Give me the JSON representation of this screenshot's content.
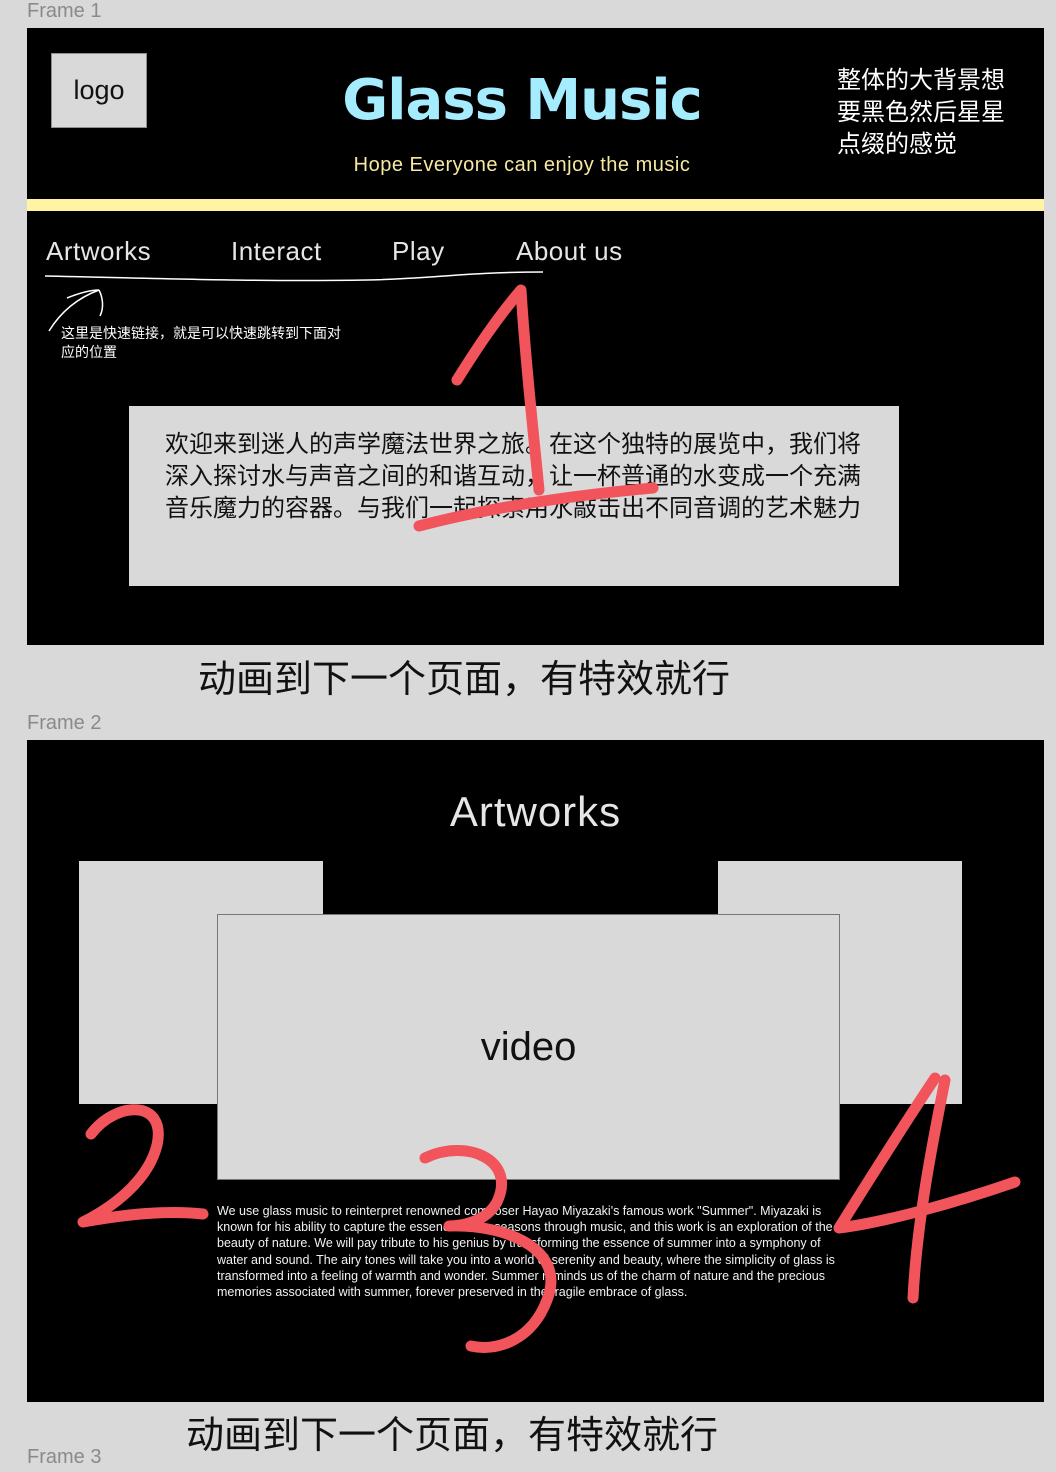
{
  "frames": [
    {
      "label": "Frame 1"
    },
    {
      "label": "Frame 2"
    },
    {
      "label": "Frame 3"
    }
  ],
  "header": {
    "logo_label": "logo",
    "title": "Glass Music",
    "subtitle": "Hope Everyone can enjoy the music",
    "background_note": "整体的大背景想要黑色然后星星点缀的感觉",
    "title_color": "#a6ecff",
    "subtitle_color": "#f7e9a0",
    "bar_color": "#fff4a3"
  },
  "nav": {
    "items": [
      {
        "label": "Artworks"
      },
      {
        "label": "Interact"
      },
      {
        "label": "Play"
      },
      {
        "label": "About us"
      }
    ],
    "note": "这里是快速链接，就是可以快速跳转到下面对应的位置"
  },
  "intro": {
    "text": "欢迎来到迷人的声学魔法世界之旅。在这个独特的展览中，我们将深入探讨水与声音之间的和谐互动，让一杯普通的水变成一个充满音乐魔力的容器。与我们一起探索用水敲击出不同音调的艺术魅力"
  },
  "captions": {
    "frame1": "动画到下一个页面，有特效就行",
    "frame2": "动画到下一个页面，有特效就行"
  },
  "artworks": {
    "title": "Artworks",
    "video_label": "video",
    "description": "We use glass music to reinterpret renowned composer Hayao Miyazaki's famous work \"Summer\". Miyazaki is known for his ability to capture the essence of the seasons through music, and this work is an exploration of the beauty of nature. We will pay tribute to his genius by transforming the essence of summer into a symphony of water and sound. The airy tones will take you into a world of serenity and beauty, where the simplicity of glass is transformed into a feeling of warmth and wonder. Summer reminds us of the charm of nature and the precious memories associated with summer, forever preserved in the fragile embrace of glass."
  },
  "annotations": {
    "marks": [
      "1",
      "2",
      "3",
      "4"
    ],
    "color": "#f2545b"
  }
}
